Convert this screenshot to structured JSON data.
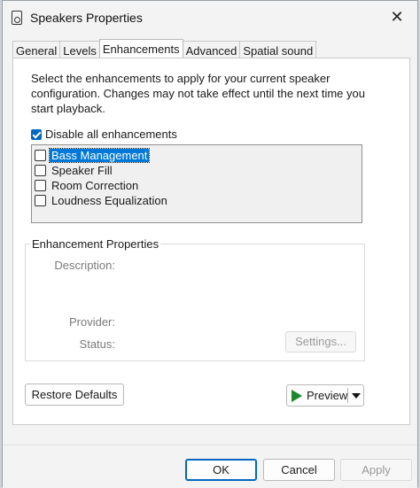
{
  "window": {
    "title": "Speakers Properties",
    "close_glyph": "✕"
  },
  "tabs": [
    {
      "label": "General",
      "active": false
    },
    {
      "label": "Levels",
      "active": false
    },
    {
      "label": "Enhancements",
      "active": true
    },
    {
      "label": "Advanced",
      "active": false
    },
    {
      "label": "Spatial sound",
      "active": false
    }
  ],
  "enhancements": {
    "intro": "Select the enhancements to apply for your current speaker configuration. Changes may not take effect until the next time you start playback.",
    "disable_all_label": "Disable all enhancements",
    "disable_all_checked": true,
    "items": [
      {
        "label": "Bass Management",
        "checked": false,
        "selected": true
      },
      {
        "label": "Speaker Fill",
        "checked": false,
        "selected": false
      },
      {
        "label": "Room Correction",
        "checked": false,
        "selected": false
      },
      {
        "label": "Loudness Equalization",
        "checked": false,
        "selected": false
      }
    ]
  },
  "properties": {
    "group_label": "Enhancement Properties",
    "description_label": "Description:",
    "provider_label": "Provider:",
    "status_label": "Status:",
    "settings_button": "Settings..."
  },
  "actions": {
    "restore_defaults": "Restore Defaults",
    "preview": "Preview"
  },
  "footer": {
    "ok": "OK",
    "cancel": "Cancel",
    "apply": "Apply"
  },
  "colors": {
    "accent": "#0067c0",
    "selection": "#0078d7",
    "play_green": "#1b8a2e"
  }
}
